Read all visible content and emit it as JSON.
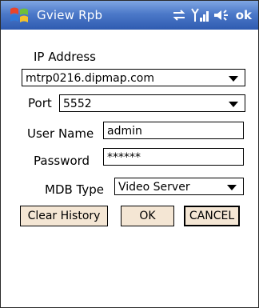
{
  "titlebar": {
    "app_title": "Gview Rpb",
    "ok_label": "ok",
    "icons": [
      "windows-start-icon",
      "connectivity-icon",
      "signal-icon",
      "speaker-icon"
    ]
  },
  "form": {
    "ip_label": "IP Address",
    "ip_value": "mtrp0216.dipmap.com",
    "port_label": "Port",
    "port_value": "5552",
    "username_label": "User Name",
    "username_value": "admin",
    "password_label": "Password",
    "password_value": "******",
    "mdb_label": "MDB Type",
    "mdb_value": "Video Server"
  },
  "buttons": {
    "clear_history": "Clear History",
    "ok": "OK",
    "cancel": "CANCEL"
  },
  "colors": {
    "titlebar_top": "#7fa6e3",
    "titlebar_bottom": "#2f5bb0",
    "button_fill": "#f4e6d4"
  }
}
